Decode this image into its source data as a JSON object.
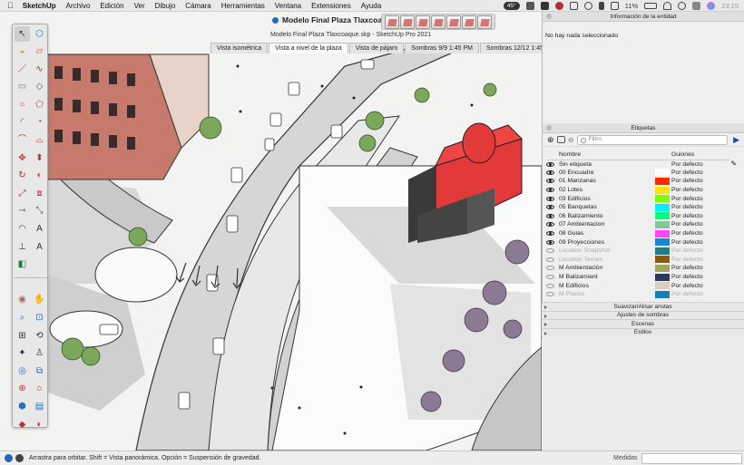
{
  "menubar": {
    "apple": "",
    "items": [
      "SketchUp",
      "Archivo",
      "Edición",
      "Ver",
      "Dibujo",
      "Cámara",
      "Herramientas",
      "Ventana",
      "Extensiones",
      "Ayuda"
    ],
    "temp": "45°",
    "battery": "11%",
    "clock": "23:15"
  },
  "window": {
    "title": "Modelo Final Plaza Tlaxcoaque",
    "subtitle": "Modelo Final Plaza Tlaxcoaque.skp - SketchUp Pro 2021"
  },
  "scene_tabs": [
    {
      "label": "Vista isométrica",
      "active": false
    },
    {
      "label": "Vista a nivel de la plaza",
      "active": true
    },
    {
      "label": "Vista de pájaro",
      "active": false
    },
    {
      "label": "Sombras 9/9 1:45 PM",
      "active": false
    },
    {
      "label": "Sombras 12/12 1:45 PM",
      "active": false
    }
  ],
  "entity_info": {
    "header": "Información de la entidad",
    "empty_text": "No hay nada seleccionado"
  },
  "tags": {
    "header": "Etiquetas",
    "filter_placeholder": "Filtro",
    "col_name": "Nombre",
    "col_dashes": "Guiones",
    "rows": [
      {
        "name": "Sin etiqueta",
        "color": "",
        "dash": "Por defecto",
        "visible": true,
        "dim": false
      },
      {
        "name": "00 Encuadre",
        "color": "#ffffff",
        "dash": "Por defecto",
        "visible": true,
        "dim": false
      },
      {
        "name": "01 Manzanas",
        "color": "#ff2a00",
        "dash": "Por defecto",
        "visible": true,
        "dim": false
      },
      {
        "name": "02 Lotes",
        "color": "#ffe600",
        "dash": "Por defecto",
        "visible": true,
        "dim": false
      },
      {
        "name": "03 Edificios",
        "color": "#7dff00",
        "dash": "Por defecto",
        "visible": true,
        "dim": false
      },
      {
        "name": "05 Banquetas",
        "color": "#00f0ff",
        "dash": "Por defecto",
        "visible": true,
        "dim": false
      },
      {
        "name": "06 Balizamiento",
        "color": "#00ff7a",
        "dash": "Por defecto",
        "visible": true,
        "dim": false
      },
      {
        "name": "07 Ambientacion",
        "color": "#7fc89a",
        "dash": "Por defecto",
        "visible": true,
        "dim": false
      },
      {
        "name": "08 Guias",
        "color": "#ff44ff",
        "dash": "Por defecto",
        "visible": true,
        "dim": false
      },
      {
        "name": "09 Proyecciones",
        "color": "#1a86d8",
        "dash": "Por defecto",
        "visible": true,
        "dim": false
      },
      {
        "name": "Location Snapshot",
        "color": "#1e7f8a",
        "dash": "Por defecto",
        "visible": false,
        "dim": true
      },
      {
        "name": "Location Terrain",
        "color": "#8a5a12",
        "dash": "Por defecto",
        "visible": false,
        "dim": true
      },
      {
        "name": "M Ambientación",
        "color": "#a7a35a",
        "dash": "Por defecto",
        "visible": false,
        "dim": false
      },
      {
        "name": "M Balizamient",
        "color": "#2a3a5a",
        "dash": "Por defecto",
        "visible": false,
        "dim": false
      },
      {
        "name": "M Edificios",
        "color": "#d8d0c0",
        "dash": "Por defecto",
        "visible": false,
        "dim": false
      },
      {
        "name": "M Planos",
        "color": "#1a7fb8",
        "dash": "Por defecto",
        "visible": false,
        "dim": true
      }
    ]
  },
  "trays": [
    "Suavizar/Alisar aristas",
    "Ajustes de sombras",
    "Escenas",
    "Estilos"
  ],
  "status": {
    "hint": "Arrastra para orbitar. Shift = Vista panorámica. Opción = Suspensión de gravedad.",
    "measure_label": "Medidas",
    "measure_value": ""
  },
  "tools": [
    "select-icon",
    "component-icon",
    "paint-bucket-icon",
    "eraser-icon",
    "line-icon",
    "freehand-icon",
    "rectangle-icon",
    "rotated-rectangle-icon",
    "circle-icon",
    "polygon-icon",
    "arc-icon",
    "pie-icon",
    "arc-2pt-icon",
    "arc-3pt-icon",
    "move-icon",
    "push-pull-icon",
    "rotate-icon",
    "follow-me-icon",
    "scale-icon",
    "offset-icon",
    "tape-measure-icon",
    "dimension-icon",
    "protractor-icon",
    "text-icon",
    "axes-icon",
    "3d-text-icon",
    "section-plane-icon",
    "",
    "orbit-icon",
    "pan-icon",
    "zoom-icon",
    "zoom-window-icon",
    "zoom-extents-icon",
    "previous-view-icon",
    "position-camera-icon",
    "walk-icon",
    "look-around-icon",
    "sandbox-icon",
    "solid-tools-icon",
    "warehouse-icon",
    "extension-icon",
    "layout-icon",
    "style-icon",
    "shadow-icon"
  ]
}
